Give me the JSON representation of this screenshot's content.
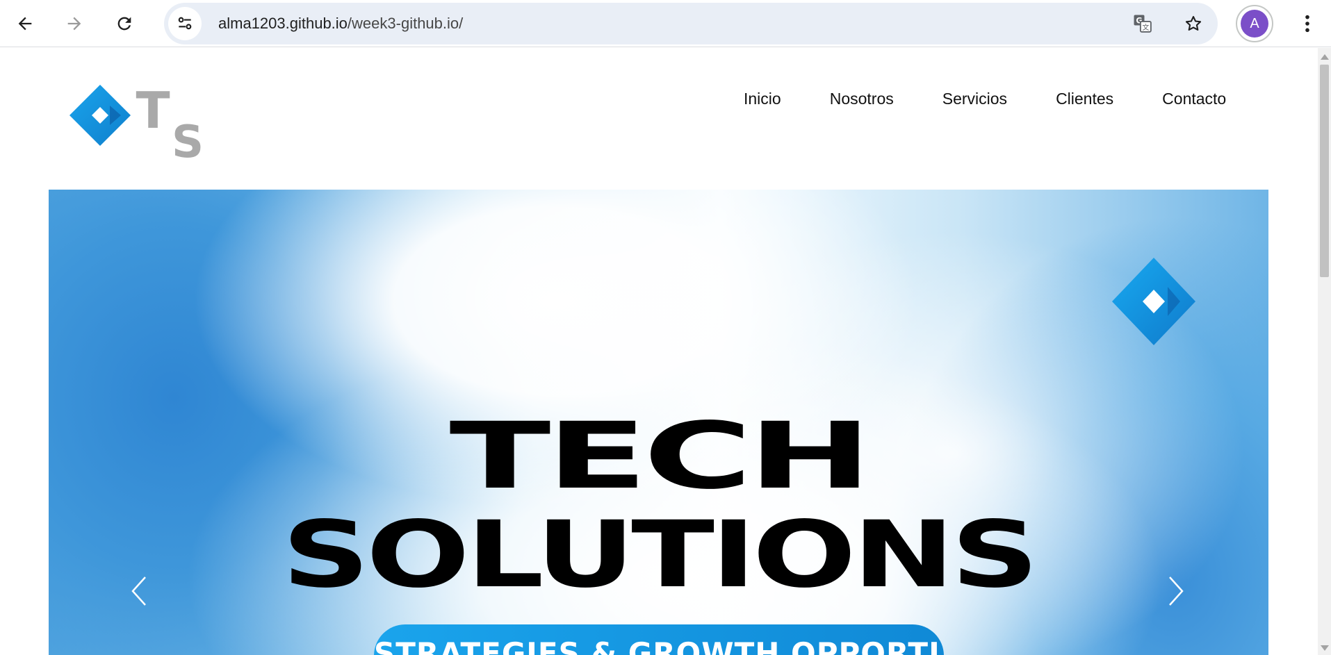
{
  "browser": {
    "url_host": "alma1203.github.io",
    "url_path": "/week3-github.io/",
    "profile_initial": "A"
  },
  "site": {
    "nav": [
      "Inicio",
      "Nosotros",
      "Servicios",
      "Clientes",
      "Contacto"
    ]
  },
  "hero": {
    "title_line1": "TECH",
    "title_line2": "SOLUTIONS",
    "tagline": "STRATEGIES & GROWTH OPPORTUNITIES"
  },
  "colors": {
    "accent_blue": "#1aa4ec",
    "profile_purple": "#7b4fc8"
  },
  "icons": {
    "back": "arrow-left-icon",
    "forward": "arrow-right-icon",
    "reload": "reload-icon",
    "site_info": "tune-icon",
    "translate": "translate-icon",
    "bookmark": "star-icon",
    "menu": "kebab-menu-icon",
    "carousel_prev": "chevron-left-icon",
    "carousel_next": "chevron-right-icon"
  }
}
